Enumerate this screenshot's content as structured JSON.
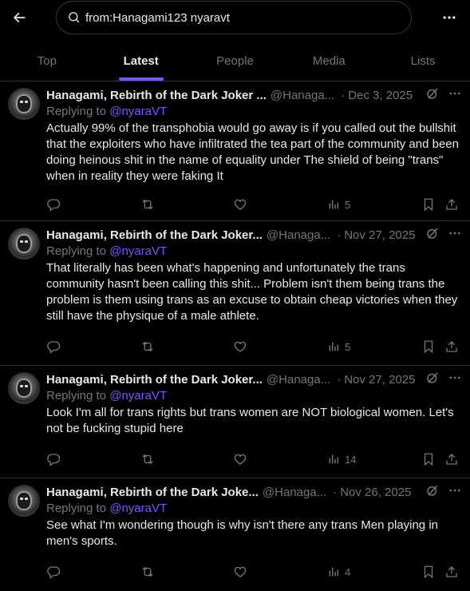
{
  "search": {
    "query": "from:Hanagami123 nyaravt"
  },
  "tabs": [
    {
      "label": "Top"
    },
    {
      "label": "Latest"
    },
    {
      "label": "People"
    },
    {
      "label": "Media"
    },
    {
      "label": "Lists"
    }
  ],
  "active_tab": "Latest",
  "colors": {
    "accent": "#7856ff",
    "background": "#000000",
    "text": "#e7e9ea",
    "muted": "#71767b",
    "border": "#2f3336"
  },
  "tweets": [
    {
      "name": "Hanagami, Rebirth of the Dark Joker ...",
      "handle": "@Hanaga...",
      "date": "Dec 3, 2025",
      "replying_prefix": "Replying to ",
      "replying_to": "@nyaraVT",
      "text": "Actually 99% of the transphobia would go away is if you called out the bullshit that the exploiters  who have infiltrated the tea part of the community and been doing heinous shit in the name of equality under The shield of being \"trans\" when in reality they were faking It",
      "views": "5"
    },
    {
      "name": "Hanagami, Rebirth of the Dark Joker...",
      "handle": "@Hanaga...",
      "date": "Nov 27, 2025",
      "replying_prefix": "Replying to ",
      "replying_to": "@nyaraVT",
      "text": "That literally has been what's happening and unfortunately the trans community hasn't been calling this shit... Problem isn't them being trans the problem is them using trans as an excuse to obtain cheap victories when they still have the physique of a male athlete.",
      "views": "5"
    },
    {
      "name": "Hanagami, Rebirth of the Dark Joker...",
      "handle": "@Hanaga...",
      "date": "Nov 27, 2025",
      "replying_prefix": "Replying to ",
      "replying_to": "@nyaraVT",
      "text": "Look I'm all for trans rights but trans women are NOT  biological women. Let's not be fucking stupid here",
      "views": "14"
    },
    {
      "name": "Hanagami, Rebirth of the Dark Joke...",
      "handle": "@Hanaga...",
      "date": "Nov 26, 2025",
      "replying_prefix": "Replying to ",
      "replying_to": "@nyaraVT",
      "text": "See what I'm wondering though is why isn't there any trans Men playing in men's sports.",
      "views": "4"
    }
  ]
}
